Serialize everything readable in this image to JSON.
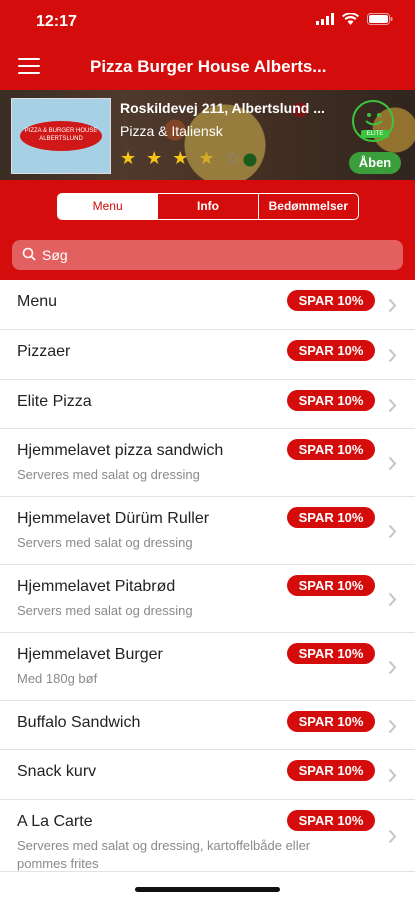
{
  "status_bar": {
    "time": "12:17"
  },
  "nav": {
    "title": "Pizza Burger House Alberts..."
  },
  "restaurant": {
    "address": "Roskildevej 211, Albertslund ...",
    "cuisine": "Pizza & Italiensk",
    "rating": 3.5,
    "logo_text": "PIZZA & BURGER HOUSE ALBERTSLUND",
    "elite_label": "ELITE",
    "status": "Åben"
  },
  "tabs": [
    "Menu",
    "Info",
    "Bedømmelser"
  ],
  "search": {
    "placeholder": "Søg"
  },
  "colors": {
    "brand_red": "#d40c0c",
    "open_green": "#3a9e3a",
    "smiley_green": "#3cc43c"
  },
  "badge_label": "SPAR 10%",
  "menu_items": [
    {
      "title": "Menu",
      "subtitle": ""
    },
    {
      "title": "Pizzaer",
      "subtitle": ""
    },
    {
      "title": "Elite Pizza",
      "subtitle": ""
    },
    {
      "title": "Hjemmelavet pizza sandwich",
      "subtitle": "Serveres med salat og dressing"
    },
    {
      "title": "Hjemmelavet Dürüm Ruller",
      "subtitle": "Servers med salat og dressing"
    },
    {
      "title": "Hjemmelavet Pitabrød",
      "subtitle": "Servers med salat og dressing"
    },
    {
      "title": "Hjemmelavet Burger",
      "subtitle": "Med 180g bøf"
    },
    {
      "title": "Buffalo Sandwich",
      "subtitle": ""
    },
    {
      "title": "Snack kurv",
      "subtitle": ""
    },
    {
      "title": "A La Carte",
      "subtitle": "Serveres med salat og dressing, kartoffelbåde eller pommes frites"
    }
  ]
}
